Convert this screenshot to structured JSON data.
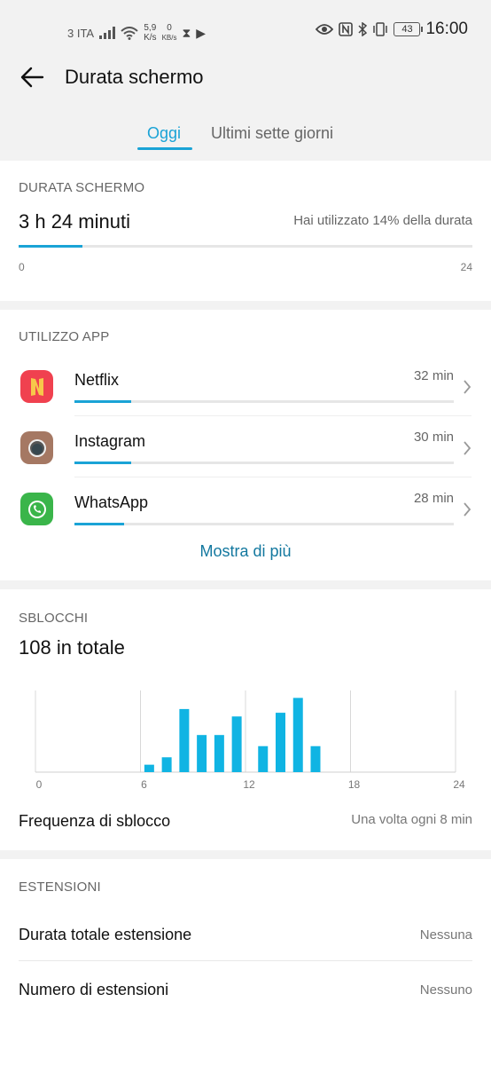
{
  "status_bar": {
    "carrier": "3 ITA",
    "speed_value": "5,9",
    "speed_unit": "K/s",
    "kbs_value": "0",
    "kbs_unit": "KB/s",
    "battery": "43",
    "time": "16:00"
  },
  "header": {
    "title": "Durata schermo"
  },
  "tabs": [
    {
      "label": "Oggi",
      "active": true
    },
    {
      "label": "Ultimi sette giorni",
      "active": false
    }
  ],
  "screen_time": {
    "section_label": "DURATA SCHERMO",
    "value": "3 h 24 minuti",
    "note": "Hai utilizzato 14% della durata",
    "progress": 0.14,
    "axis_start": "0",
    "axis_end": "24"
  },
  "app_usage": {
    "section_label": "UTILIZZO APP",
    "apps": [
      {
        "name": "Netflix",
        "minutes": "32 min",
        "progress": 0.15
      },
      {
        "name": "Instagram",
        "minutes": "30 min",
        "progress": 0.15
      },
      {
        "name": "WhatsApp",
        "minutes": "28 min",
        "progress": 0.13
      }
    ],
    "more_label": "Mostra di più"
  },
  "unlocks": {
    "section_label": "SBLOCCHI",
    "total": "108 in totale",
    "freq_label": "Frequenza di sblocco",
    "freq_value": "Una volta ogni 8 min",
    "chart_data": {
      "type": "bar",
      "x_ticks": [
        "0",
        "6",
        "12",
        "18",
        "24"
      ],
      "hours": [
        6.5,
        7.5,
        8.5,
        9.5,
        10.5,
        11.5,
        13,
        14,
        15,
        16
      ],
      "values": [
        2,
        4,
        17,
        10,
        10,
        15,
        7,
        16,
        20,
        7
      ],
      "xlim": [
        0,
        24
      ],
      "ylim": [
        0,
        22
      ],
      "grid": true,
      "color": "#10b4e3"
    }
  },
  "extensions": {
    "section_label": "ESTENSIONI",
    "rows": [
      {
        "label": "Durata totale estensione",
        "value": "Nessuna"
      },
      {
        "label": "Numero di estensioni",
        "value": "Nessuno"
      }
    ]
  },
  "colors": {
    "accent": "#1aa3d6",
    "link": "#13789f",
    "bar": "#10b4e3"
  }
}
